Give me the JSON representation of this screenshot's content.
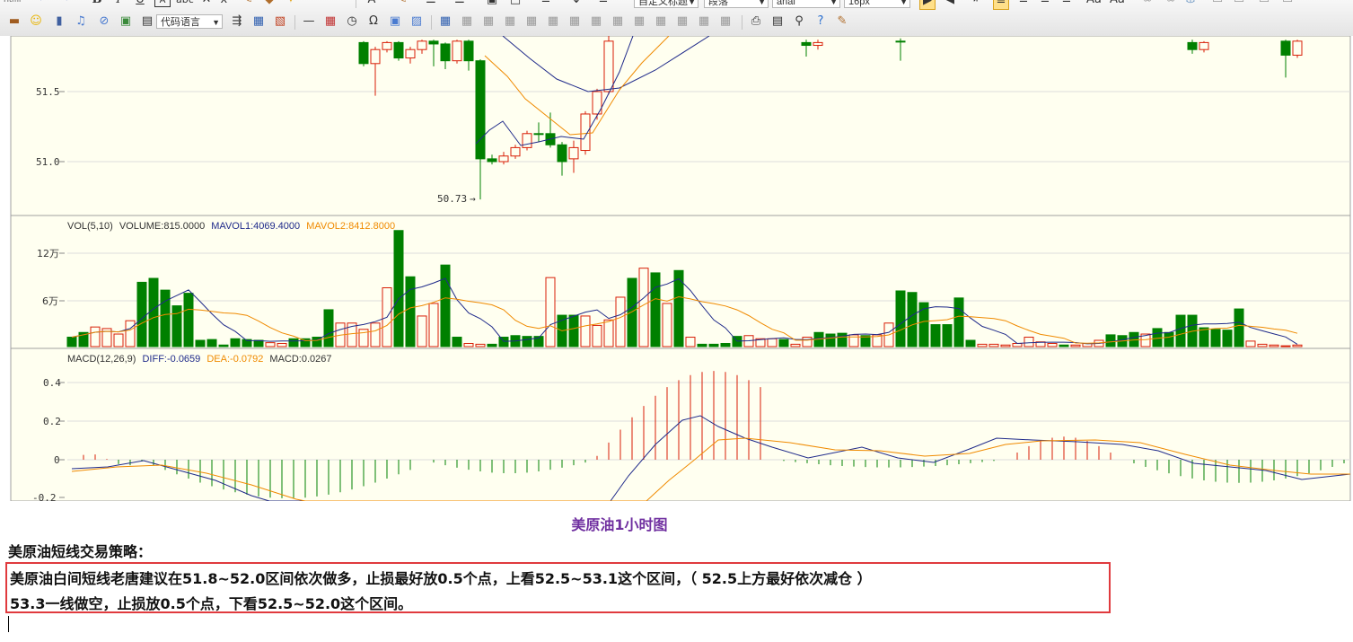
{
  "toolbar": {
    "row1": {
      "source_label": "Html",
      "bold": "B",
      "italic": "I",
      "underline": "U",
      "font_color": "A",
      "text_color": "A",
      "paragraph_format": "自定义标题",
      "paragraph": "段落",
      "font_family": "arial",
      "font_size": "16px"
    },
    "row2": {
      "code_language": "代码语言"
    },
    "icons": [
      "source-icon",
      "undo-icon",
      "redo-icon",
      "bold-icon",
      "italic-icon",
      "underline-icon",
      "font-border-icon",
      "strikethrough-icon",
      "eraser-icon",
      "superscript-icon",
      "subscript-icon",
      "format-brush-icon",
      "auto-format-icon",
      "paste-icon",
      "blockquote-icon",
      "font-color-icon",
      "highlight-icon",
      "ordered-list-icon",
      "unordered-list-icon",
      "select-all-icon",
      "clear-doc-icon",
      "line-height-icon",
      "row-spacing-top-icon",
      "row-spacing-bottom-icon",
      "align-left-icon",
      "align-center-icon",
      "align-right-icon",
      "justify-icon",
      "image-icon",
      "emotion-icon",
      "video-icon",
      "music-icon",
      "attachment-icon",
      "map-icon",
      "insert-code-icon",
      "page-break-icon",
      "horizontal-rule-icon",
      "date-icon",
      "time-icon",
      "special-char-icon",
      "snapscreen-icon",
      "wordimage-icon",
      "table-icon",
      "merge-cells-icon",
      "print-icon",
      "preview-icon",
      "search-replace-icon",
      "help-icon",
      "template-icon"
    ]
  },
  "chart_data": [
    {
      "type": "candlestick",
      "price_labels": [
        "51.5",
        "51.0"
      ],
      "low_annotation": "50.73",
      "y_range": [
        50.7,
        51.85
      ],
      "grid": true
    },
    {
      "type": "bar",
      "legend_prefix": "VOL(5,10)",
      "volume_label": "VOLUME:815.0000",
      "mavol1_label": "MAVOL1:4069.4000",
      "mavol2_label": "MAVOL2:8412.8000",
      "tick_labels": [
        "12万",
        "6万"
      ],
      "y_range": [
        0,
        150000
      ],
      "values": [
        12000,
        18000,
        25000,
        23000,
        16000,
        33000,
        82000,
        87000,
        72000,
        52000,
        68000,
        8000,
        9000,
        2000,
        10000,
        9000,
        8000,
        5000,
        4000,
        10000,
        10000,
        12000,
        47000,
        30000,
        30000,
        22000,
        30000,
        75000,
        148000,
        89000,
        39000,
        55000,
        104000,
        12000,
        4000,
        3000,
        3000,
        12000,
        14000,
        13000,
        13000,
        88000,
        40000,
        40000,
        39000,
        27000,
        34000,
        63000,
        87000,
        100000,
        94000,
        55000,
        97000,
        12000,
        3000,
        3000,
        4000,
        13000,
        14000,
        10000,
        10000,
        9000,
        3000,
        12000,
        18000,
        16000,
        17000,
        15000,
        14000,
        15000,
        30000,
        71000,
        69000,
        56000,
        28000,
        28000,
        62000,
        8000,
        3000,
        3000,
        2000,
        4000,
        12000,
        6000,
        4000,
        2000,
        2000,
        4000,
        8000,
        15000,
        14000,
        18000,
        16000,
        23000,
        18000,
        40000,
        40000,
        24000,
        22000,
        21000,
        48000,
        7000,
        3000,
        2000,
        1000,
        2000
      ],
      "up": [
        0,
        0,
        1,
        1,
        1,
        1,
        0,
        0,
        0,
        0,
        0,
        0,
        0,
        0,
        0,
        0,
        0,
        1,
        1,
        0,
        0,
        0,
        0,
        1,
        1,
        1,
        1,
        1,
        0,
        0,
        1,
        1,
        0,
        0,
        1,
        1,
        0,
        0,
        0,
        0,
        0,
        1,
        0,
        0,
        1,
        1,
        1,
        1,
        0,
        1,
        0,
        1,
        0,
        1,
        0,
        0,
        0,
        0,
        1,
        1,
        1,
        0,
        1,
        1,
        0,
        0,
        0,
        1,
        0,
        1,
        1,
        0,
        0,
        0,
        0,
        0,
        0,
        0,
        1,
        1,
        1,
        1,
        1,
        1,
        1,
        0,
        1,
        1,
        1,
        0,
        0,
        0,
        1,
        0,
        0,
        0,
        0,
        0,
        0,
        0,
        0,
        1,
        1,
        1,
        1,
        1
      ]
    },
    {
      "type": "macd",
      "legend_prefix": "MACD(12,26,9)",
      "diff_label": "DIFF:-0.0659",
      "dea_label": "DEA:-0.0792",
      "macd_label": "MACD:0.0267",
      "tick_labels": [
        "0.4",
        "0.2",
        "0",
        "-0.2"
      ],
      "y_range": [
        -0.22,
        0.48
      ]
    }
  ],
  "colors": {
    "chart_bg": "#fffff0",
    "up": "#d81e06",
    "down": "#008000",
    "ma_blue": "#1f2a8a",
    "ma_orange": "#f08a00",
    "caption": "#7030a0",
    "box_border": "#e03a3e"
  },
  "content": {
    "caption": "美原油1小时图",
    "heading": "美原油短线交易策略：",
    "line1": "美原油白间短线老唐建议在51.8~52.0区间依次做多，止损最好放0.5个点，上看52.5~53.1这个区间，（ 52.5上方最好依次减仓 ）",
    "line2": "53.3一线做空，止损放0.5个点，下看52.5~52.0这个区间。"
  }
}
